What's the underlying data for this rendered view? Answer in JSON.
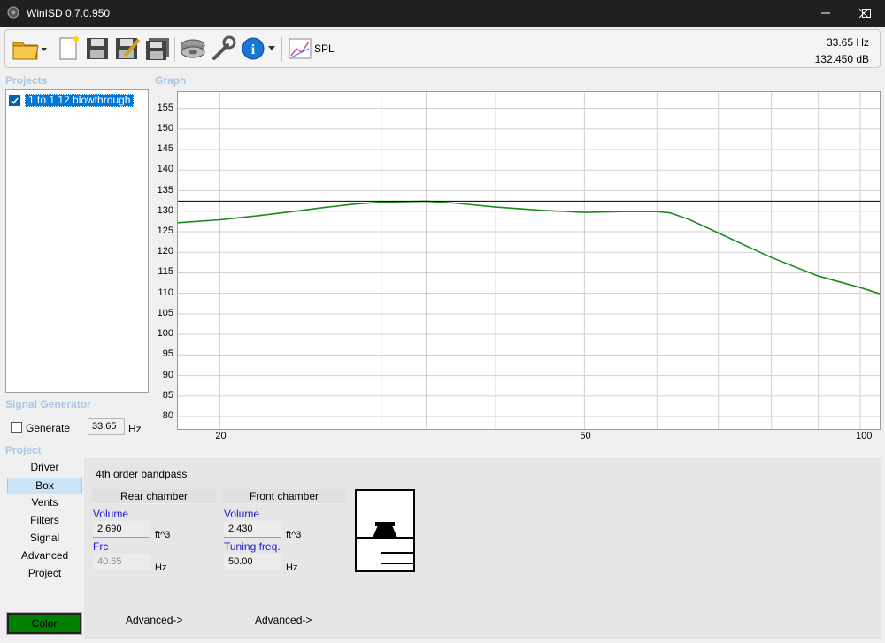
{
  "window": {
    "title": "WinISD 0.7.0.950"
  },
  "toolbar": {
    "spl_label": "SPL",
    "readout_freq": "33.65 Hz",
    "readout_db": "132.450 dB"
  },
  "projects": {
    "title": "Projects",
    "items": [
      {
        "label": "1 to 1 12 blowthrough",
        "checked": true
      }
    ]
  },
  "graph": {
    "title": "Graph"
  },
  "chart_data": {
    "type": "line",
    "x_scale": "log",
    "xlim": [
      18,
      105
    ],
    "ylim": [
      77,
      159
    ],
    "x_ticks": [
      "20",
      "50",
      "100"
    ],
    "y_ticks": [
      "155",
      "150",
      "145",
      "140",
      "135",
      "130",
      "125",
      "120",
      "115",
      "110",
      "105",
      "100",
      "95",
      "90",
      "85",
      "80"
    ],
    "series": [
      {
        "color": "#1a8a1a",
        "x": [
          18,
          20,
          22,
          24,
          26,
          28,
          30,
          33.65,
          36,
          40,
          45,
          50,
          55,
          60,
          62,
          65,
          70,
          75,
          80,
          90,
          100,
          105
        ],
        "y": [
          127.2,
          127.9,
          128.9,
          129.9,
          130.9,
          131.7,
          132.2,
          132.45,
          132.0,
          131.0,
          130.2,
          129.7,
          129.9,
          129.9,
          129.6,
          128.0,
          124.7,
          121.6,
          118.7,
          114.2,
          111.4,
          109.9
        ]
      }
    ],
    "cursor": {
      "x": 33.65,
      "y": 132.45
    },
    "grid": true
  },
  "signal_generator": {
    "title": "Signal Generator",
    "generate_label": "Generate",
    "generate_checked": false,
    "frequency": "33.65",
    "unit": "Hz"
  },
  "project": {
    "title": "Project",
    "tabs": [
      "Driver",
      "Box",
      "Vents",
      "Filters",
      "Signal",
      "Advanced",
      "Project"
    ],
    "active_tab": "Box",
    "color_label": "Color",
    "color": "#008000"
  },
  "box": {
    "type": "4th order bandpass",
    "rear": {
      "header": "Rear chamber",
      "volume_label": "Volume",
      "volume": "2.690",
      "volume_unit": "ft^3",
      "frc_label": "Frc",
      "frc": "40.65",
      "frc_unit": "Hz",
      "advanced": "Advanced->"
    },
    "front": {
      "header": "Front chamber",
      "volume_label": "Volume",
      "volume": "2.430",
      "volume_unit": "ft^3",
      "tuning_label": "Tuning freq.",
      "tuning": "50.00",
      "tuning_unit": "Hz",
      "advanced": "Advanced->"
    }
  }
}
